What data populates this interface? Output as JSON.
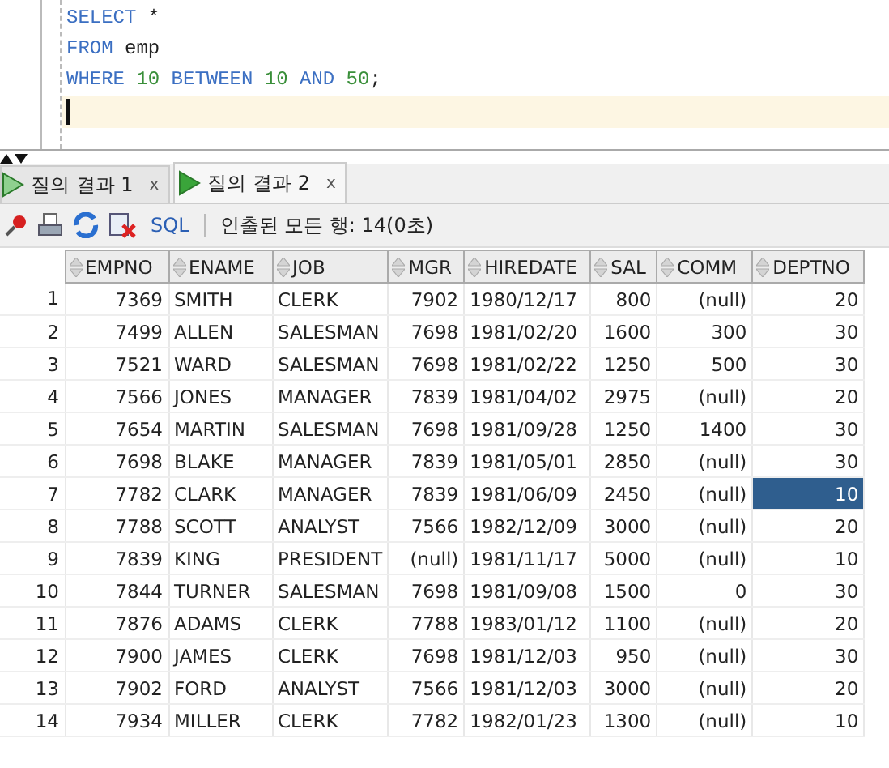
{
  "editor": {
    "lines": [
      [
        {
          "kind": "keyword",
          "text": "SELECT"
        },
        {
          "kind": "plain",
          "text": "*"
        }
      ],
      [
        {
          "kind": "keyword",
          "text": "FROM"
        },
        {
          "kind": "plain",
          "text": "emp"
        }
      ],
      [
        {
          "kind": "keyword",
          "text": "WHERE"
        },
        {
          "kind": "number",
          "text": "10"
        },
        {
          "kind": "keyword",
          "text": "BETWEEN"
        },
        {
          "kind": "number",
          "text": "10"
        },
        {
          "kind": "keyword",
          "text": "AND"
        },
        {
          "kind": "number",
          "text": "50"
        },
        {
          "kind": "plain",
          "text": ";",
          "joined": true
        }
      ]
    ]
  },
  "tabs": [
    {
      "label": "질의 결과 1",
      "close": "x",
      "selected": false
    },
    {
      "label": "질의 결과 2",
      "close": "x",
      "selected": true
    }
  ],
  "toolbar": {
    "sql_link": "SQL",
    "status": "인출된 모든 행: 14(0초)"
  },
  "table": {
    "columns": [
      {
        "name": "EMPNO",
        "kind": "number"
      },
      {
        "name": "ENAME",
        "kind": "text"
      },
      {
        "name": "JOB",
        "kind": "text"
      },
      {
        "name": "MGR",
        "kind": "number"
      },
      {
        "name": "HIREDATE",
        "kind": "text"
      },
      {
        "name": "SAL",
        "kind": "number"
      },
      {
        "name": "COMM",
        "kind": "number"
      },
      {
        "name": "DEPTNO",
        "kind": "number"
      }
    ],
    "rows": [
      {
        "num": "1",
        "cells": [
          {
            "text": "7369",
            "selected": false
          },
          {
            "text": "SMITH",
            "selected": false
          },
          {
            "text": "CLERK",
            "selected": false
          },
          {
            "text": "7902",
            "selected": false
          },
          {
            "text": "1980/12/17",
            "selected": false
          },
          {
            "text": "800",
            "selected": false
          },
          {
            "text": "(null)",
            "selected": false
          },
          {
            "text": "20",
            "selected": false
          }
        ]
      },
      {
        "num": "2",
        "cells": [
          {
            "text": "7499",
            "selected": false
          },
          {
            "text": "ALLEN",
            "selected": false
          },
          {
            "text": "SALESMAN",
            "selected": false
          },
          {
            "text": "7698",
            "selected": false
          },
          {
            "text": "1981/02/20",
            "selected": false
          },
          {
            "text": "1600",
            "selected": false
          },
          {
            "text": "300",
            "selected": false
          },
          {
            "text": "30",
            "selected": false
          }
        ]
      },
      {
        "num": "3",
        "cells": [
          {
            "text": "7521",
            "selected": false
          },
          {
            "text": "WARD",
            "selected": false
          },
          {
            "text": "SALESMAN",
            "selected": false
          },
          {
            "text": "7698",
            "selected": false
          },
          {
            "text": "1981/02/22",
            "selected": false
          },
          {
            "text": "1250",
            "selected": false
          },
          {
            "text": "500",
            "selected": false
          },
          {
            "text": "30",
            "selected": false
          }
        ]
      },
      {
        "num": "4",
        "cells": [
          {
            "text": "7566",
            "selected": false
          },
          {
            "text": "JONES",
            "selected": false
          },
          {
            "text": "MANAGER",
            "selected": false
          },
          {
            "text": "7839",
            "selected": false
          },
          {
            "text": "1981/04/02",
            "selected": false
          },
          {
            "text": "2975",
            "selected": false
          },
          {
            "text": "(null)",
            "selected": false
          },
          {
            "text": "20",
            "selected": false
          }
        ]
      },
      {
        "num": "5",
        "cells": [
          {
            "text": "7654",
            "selected": false
          },
          {
            "text": "MARTIN",
            "selected": false
          },
          {
            "text": "SALESMAN",
            "selected": false
          },
          {
            "text": "7698",
            "selected": false
          },
          {
            "text": "1981/09/28",
            "selected": false
          },
          {
            "text": "1250",
            "selected": false
          },
          {
            "text": "1400",
            "selected": false
          },
          {
            "text": "30",
            "selected": false
          }
        ]
      },
      {
        "num": "6",
        "cells": [
          {
            "text": "7698",
            "selected": false
          },
          {
            "text": "BLAKE",
            "selected": false
          },
          {
            "text": "MANAGER",
            "selected": false
          },
          {
            "text": "7839",
            "selected": false
          },
          {
            "text": "1981/05/01",
            "selected": false
          },
          {
            "text": "2850",
            "selected": false
          },
          {
            "text": "(null)",
            "selected": false
          },
          {
            "text": "30",
            "selected": false
          }
        ]
      },
      {
        "num": "7",
        "cells": [
          {
            "text": "7782",
            "selected": false
          },
          {
            "text": "CLARK",
            "selected": false
          },
          {
            "text": "MANAGER",
            "selected": false
          },
          {
            "text": "7839",
            "selected": false
          },
          {
            "text": "1981/06/09",
            "selected": false
          },
          {
            "text": "2450",
            "selected": false
          },
          {
            "text": "(null)",
            "selected": false
          },
          {
            "text": "10",
            "selected": true
          }
        ]
      },
      {
        "num": "8",
        "cells": [
          {
            "text": "7788",
            "selected": false
          },
          {
            "text": "SCOTT",
            "selected": false
          },
          {
            "text": "ANALYST",
            "selected": false
          },
          {
            "text": "7566",
            "selected": false
          },
          {
            "text": "1982/12/09",
            "selected": false
          },
          {
            "text": "3000",
            "selected": false
          },
          {
            "text": "(null)",
            "selected": false
          },
          {
            "text": "20",
            "selected": false
          }
        ]
      },
      {
        "num": "9",
        "cells": [
          {
            "text": "7839",
            "selected": false
          },
          {
            "text": "KING",
            "selected": false
          },
          {
            "text": "PRESIDENT",
            "selected": false
          },
          {
            "text": "(null)",
            "selected": false
          },
          {
            "text": "1981/11/17",
            "selected": false
          },
          {
            "text": "5000",
            "selected": false
          },
          {
            "text": "(null)",
            "selected": false
          },
          {
            "text": "10",
            "selected": false
          }
        ]
      },
      {
        "num": "10",
        "cells": [
          {
            "text": "7844",
            "selected": false
          },
          {
            "text": "TURNER",
            "selected": false
          },
          {
            "text": "SALESMAN",
            "selected": false
          },
          {
            "text": "7698",
            "selected": false
          },
          {
            "text": "1981/09/08",
            "selected": false
          },
          {
            "text": "1500",
            "selected": false
          },
          {
            "text": "0",
            "selected": false
          },
          {
            "text": "30",
            "selected": false
          }
        ]
      },
      {
        "num": "11",
        "cells": [
          {
            "text": "7876",
            "selected": false
          },
          {
            "text": "ADAMS",
            "selected": false
          },
          {
            "text": "CLERK",
            "selected": false
          },
          {
            "text": "7788",
            "selected": false
          },
          {
            "text": "1983/01/12",
            "selected": false
          },
          {
            "text": "1100",
            "selected": false
          },
          {
            "text": "(null)",
            "selected": false
          },
          {
            "text": "20",
            "selected": false
          }
        ]
      },
      {
        "num": "12",
        "cells": [
          {
            "text": "7900",
            "selected": false
          },
          {
            "text": "JAMES",
            "selected": false
          },
          {
            "text": "CLERK",
            "selected": false
          },
          {
            "text": "7698",
            "selected": false
          },
          {
            "text": "1981/12/03",
            "selected": false
          },
          {
            "text": "950",
            "selected": false
          },
          {
            "text": "(null)",
            "selected": false
          },
          {
            "text": "30",
            "selected": false
          }
        ]
      },
      {
        "num": "13",
        "cells": [
          {
            "text": "7902",
            "selected": false
          },
          {
            "text": "FORD",
            "selected": false
          },
          {
            "text": "ANALYST",
            "selected": false
          },
          {
            "text": "7566",
            "selected": false
          },
          {
            "text": "1981/12/03",
            "selected": false
          },
          {
            "text": "3000",
            "selected": false
          },
          {
            "text": "(null)",
            "selected": false
          },
          {
            "text": "20",
            "selected": false
          }
        ]
      },
      {
        "num": "14",
        "cells": [
          {
            "text": "7934",
            "selected": false
          },
          {
            "text": "MILLER",
            "selected": false
          },
          {
            "text": "CLERK",
            "selected": false
          },
          {
            "text": "7782",
            "selected": false
          },
          {
            "text": "1982/01/23",
            "selected": false
          },
          {
            "text": "1300",
            "selected": false
          },
          {
            "text": "(null)",
            "selected": false
          },
          {
            "text": "10",
            "selected": false
          }
        ]
      }
    ]
  }
}
